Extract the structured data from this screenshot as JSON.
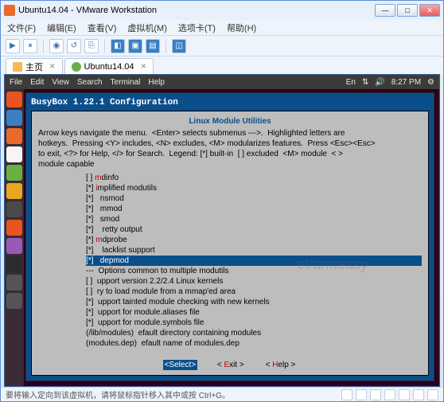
{
  "window": {
    "title": "Ubuntu14.04 - VMware Workstation",
    "menubar": [
      "文件(F)",
      "编辑(E)",
      "查看(V)",
      "虚拟机(M)",
      "选项卡(T)",
      "帮助(H)"
    ],
    "tabs": [
      {
        "label": "主页"
      },
      {
        "label": "Ubuntu14.04"
      }
    ]
  },
  "ubuntu": {
    "topmenu": [
      "File",
      "Edit",
      "View",
      "Search",
      "Terminal",
      "Help"
    ],
    "indicators": {
      "lang": "En",
      "time": "8:27 PM"
    }
  },
  "busybox": {
    "title": "BusyBox 1.22.1 Configuration",
    "section": "Linux Module Utilities",
    "help": "Arrow keys navigate the menu.  <Enter> selects submenus --->.  Highlighted letters are\nhotkeys.  Pressing <Y> includes, <N> excludes, <M> modularizes features.  Press <Esc><Esc>\nto exit, <?> for Help, </> for Search.  Legend: [*] built-in  [ ] excluded  <M> module  < >\nmodule capable",
    "items": [
      {
        "mark": "[ ]",
        "sub": "m",
        "text": "dinfo",
        "sel": false
      },
      {
        "mark": "[*]",
        "sub": "i",
        "text": "mplified modutils",
        "sel": false
      },
      {
        "mark": "[*]",
        "sub": " ",
        "text": " nsmod",
        "sel": false
      },
      {
        "mark": "[*]",
        "sub": " ",
        "text": " mmod",
        "sel": false
      },
      {
        "mark": "[*]",
        "sub": " ",
        "text": " smod",
        "sel": false
      },
      {
        "mark": "[*]",
        "sub": " ",
        "text": "  retty output",
        "sel": false
      },
      {
        "mark": "[*]",
        "sub": "m",
        "text": "dprobe",
        "sel": false
      },
      {
        "mark": "[*]",
        "sub": " ",
        "text": "  lacklist support",
        "sel": false
      },
      {
        "mark": "[*]",
        "sub": " ",
        "text": " depmod",
        "sel": true
      },
      {
        "mark": "---",
        "sub": "",
        "text": " Options common to multiple modutils",
        "sel": false
      },
      {
        "mark": "[ ]",
        "sub": " ",
        "text": "upport version 2.2/2.4 Linux kernels",
        "sel": false
      },
      {
        "mark": "[ ]",
        "sub": " ",
        "text": "ry to load module from a mmap'ed area",
        "sel": false
      },
      {
        "mark": "[*]",
        "sub": " ",
        "text": "upport tainted module checking with new kernels",
        "sel": false
      },
      {
        "mark": "[*]",
        "sub": " ",
        "text": "upport for module.aliases file",
        "sel": false
      },
      {
        "mark": "[*]",
        "sub": " ",
        "text": "upport for module.symbols file",
        "sel": false
      },
      {
        "mark": "(/lib/modules)",
        "sub": " ",
        "text": "efault directory containing modules",
        "sel": false
      },
      {
        "mark": "(modules.dep)",
        "sub": " ",
        "text": "efault name of modules.dep",
        "sel": false
      }
    ],
    "buttons": {
      "select": "<Select>",
      "exit": "< Exit >",
      "help": "< Help >"
    }
  },
  "statusbar": {
    "text": "要将输入定向到该虚拟机，请将鼠标指针移入其中或按 Ctrl+G。"
  },
  "launcher_colors": [
    "#e95420",
    "#3a7fc4",
    "#e96a2b",
    "#f5f5f5",
    "#68b03f",
    "#e9a820",
    "#4a4a4a",
    "#e95420",
    "#9b59b6",
    "#2c2c2c",
    "#555",
    "#555"
  ],
  "watermark": "et/armeasy"
}
